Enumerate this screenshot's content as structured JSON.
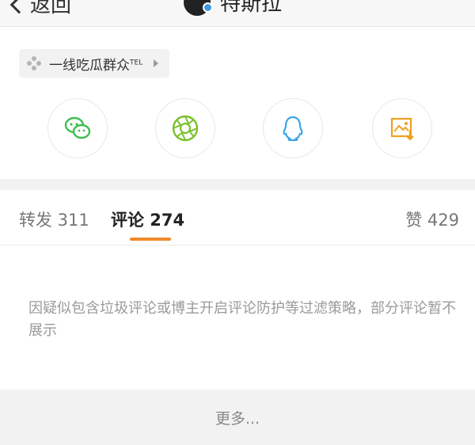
{
  "nav": {
    "back_label": "返回",
    "title": "特斯拉"
  },
  "source_chip": {
    "label": "一线吃瓜群众",
    "suffix": "TEL"
  },
  "share_buttons": [
    {
      "name": "wechat-icon",
      "color": "#3fbf52"
    },
    {
      "name": "moments-icon",
      "color": "#7cc12d"
    },
    {
      "name": "qq-icon",
      "color": "#3aa6e8"
    },
    {
      "name": "save-image-icon",
      "color": "#f0a020"
    }
  ],
  "tabs": {
    "repost": "转发 311",
    "comment": "评论 274",
    "like": "赞 429"
  },
  "accent_color": "#f08a2b",
  "notice": "因疑似包含垃圾评论或博主开启评论防护等过滤策略，部分评论暂不展示",
  "more_label": "更多..."
}
